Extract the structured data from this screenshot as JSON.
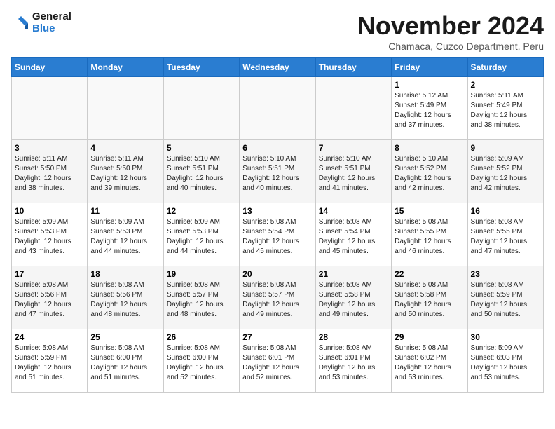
{
  "logo": {
    "line1": "General",
    "line2": "Blue"
  },
  "title": "November 2024",
  "subtitle": "Chamaca, Cuzco Department, Peru",
  "weekdays": [
    "Sunday",
    "Monday",
    "Tuesday",
    "Wednesday",
    "Thursday",
    "Friday",
    "Saturday"
  ],
  "weeks": [
    [
      {
        "day": "",
        "info": ""
      },
      {
        "day": "",
        "info": ""
      },
      {
        "day": "",
        "info": ""
      },
      {
        "day": "",
        "info": ""
      },
      {
        "day": "",
        "info": ""
      },
      {
        "day": "1",
        "info": "Sunrise: 5:12 AM\nSunset: 5:49 PM\nDaylight: 12 hours\nand 37 minutes."
      },
      {
        "day": "2",
        "info": "Sunrise: 5:11 AM\nSunset: 5:49 PM\nDaylight: 12 hours\nand 38 minutes."
      }
    ],
    [
      {
        "day": "3",
        "info": "Sunrise: 5:11 AM\nSunset: 5:50 PM\nDaylight: 12 hours\nand 38 minutes."
      },
      {
        "day": "4",
        "info": "Sunrise: 5:11 AM\nSunset: 5:50 PM\nDaylight: 12 hours\nand 39 minutes."
      },
      {
        "day": "5",
        "info": "Sunrise: 5:10 AM\nSunset: 5:51 PM\nDaylight: 12 hours\nand 40 minutes."
      },
      {
        "day": "6",
        "info": "Sunrise: 5:10 AM\nSunset: 5:51 PM\nDaylight: 12 hours\nand 40 minutes."
      },
      {
        "day": "7",
        "info": "Sunrise: 5:10 AM\nSunset: 5:51 PM\nDaylight: 12 hours\nand 41 minutes."
      },
      {
        "day": "8",
        "info": "Sunrise: 5:10 AM\nSunset: 5:52 PM\nDaylight: 12 hours\nand 42 minutes."
      },
      {
        "day": "9",
        "info": "Sunrise: 5:09 AM\nSunset: 5:52 PM\nDaylight: 12 hours\nand 42 minutes."
      }
    ],
    [
      {
        "day": "10",
        "info": "Sunrise: 5:09 AM\nSunset: 5:53 PM\nDaylight: 12 hours\nand 43 minutes."
      },
      {
        "day": "11",
        "info": "Sunrise: 5:09 AM\nSunset: 5:53 PM\nDaylight: 12 hours\nand 44 minutes."
      },
      {
        "day": "12",
        "info": "Sunrise: 5:09 AM\nSunset: 5:53 PM\nDaylight: 12 hours\nand 44 minutes."
      },
      {
        "day": "13",
        "info": "Sunrise: 5:08 AM\nSunset: 5:54 PM\nDaylight: 12 hours\nand 45 minutes."
      },
      {
        "day": "14",
        "info": "Sunrise: 5:08 AM\nSunset: 5:54 PM\nDaylight: 12 hours\nand 45 minutes."
      },
      {
        "day": "15",
        "info": "Sunrise: 5:08 AM\nSunset: 5:55 PM\nDaylight: 12 hours\nand 46 minutes."
      },
      {
        "day": "16",
        "info": "Sunrise: 5:08 AM\nSunset: 5:55 PM\nDaylight: 12 hours\nand 47 minutes."
      }
    ],
    [
      {
        "day": "17",
        "info": "Sunrise: 5:08 AM\nSunset: 5:56 PM\nDaylight: 12 hours\nand 47 minutes."
      },
      {
        "day": "18",
        "info": "Sunrise: 5:08 AM\nSunset: 5:56 PM\nDaylight: 12 hours\nand 48 minutes."
      },
      {
        "day": "19",
        "info": "Sunrise: 5:08 AM\nSunset: 5:57 PM\nDaylight: 12 hours\nand 48 minutes."
      },
      {
        "day": "20",
        "info": "Sunrise: 5:08 AM\nSunset: 5:57 PM\nDaylight: 12 hours\nand 49 minutes."
      },
      {
        "day": "21",
        "info": "Sunrise: 5:08 AM\nSunset: 5:58 PM\nDaylight: 12 hours\nand 49 minutes."
      },
      {
        "day": "22",
        "info": "Sunrise: 5:08 AM\nSunset: 5:58 PM\nDaylight: 12 hours\nand 50 minutes."
      },
      {
        "day": "23",
        "info": "Sunrise: 5:08 AM\nSunset: 5:59 PM\nDaylight: 12 hours\nand 50 minutes."
      }
    ],
    [
      {
        "day": "24",
        "info": "Sunrise: 5:08 AM\nSunset: 5:59 PM\nDaylight: 12 hours\nand 51 minutes."
      },
      {
        "day": "25",
        "info": "Sunrise: 5:08 AM\nSunset: 6:00 PM\nDaylight: 12 hours\nand 51 minutes."
      },
      {
        "day": "26",
        "info": "Sunrise: 5:08 AM\nSunset: 6:00 PM\nDaylight: 12 hours\nand 52 minutes."
      },
      {
        "day": "27",
        "info": "Sunrise: 5:08 AM\nSunset: 6:01 PM\nDaylight: 12 hours\nand 52 minutes."
      },
      {
        "day": "28",
        "info": "Sunrise: 5:08 AM\nSunset: 6:01 PM\nDaylight: 12 hours\nand 53 minutes."
      },
      {
        "day": "29",
        "info": "Sunrise: 5:08 AM\nSunset: 6:02 PM\nDaylight: 12 hours\nand 53 minutes."
      },
      {
        "day": "30",
        "info": "Sunrise: 5:09 AM\nSunset: 6:03 PM\nDaylight: 12 hours\nand 53 minutes."
      }
    ]
  ]
}
